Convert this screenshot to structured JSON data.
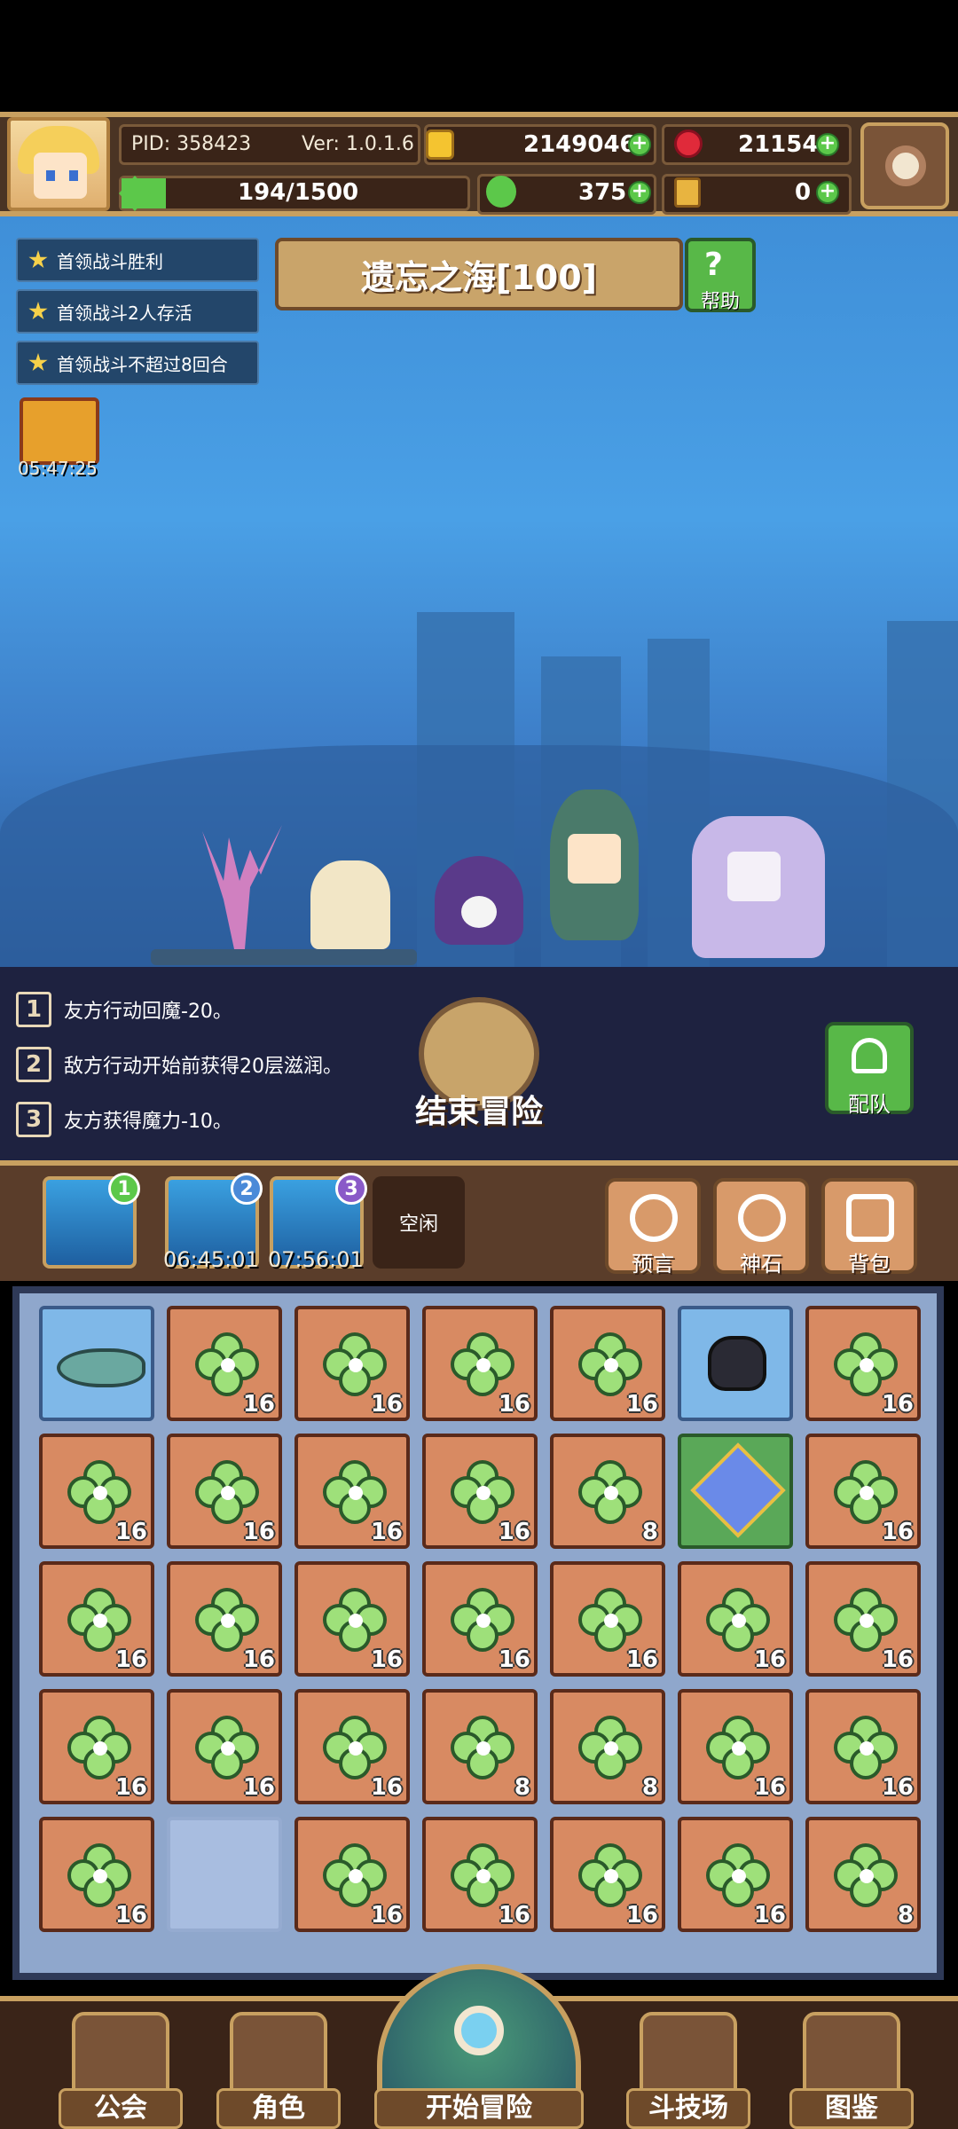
{
  "header": {
    "pid": "PID: 358423",
    "version": "Ver: 1.0.1.6",
    "exp": "194/1500",
    "exp_fraction": 0.129,
    "gold": "2149046",
    "gems": "21154",
    "clovers": "375",
    "keys": "0"
  },
  "quests": [
    "首领战斗胜利",
    "首领战斗2人存活",
    "首领战斗不超过8回合"
  ],
  "gift_timer": "05:47:25",
  "stage": {
    "title": "遗忘之海[100]",
    "help_label": "帮助"
  },
  "effects": [
    {
      "num": "1",
      "text": "友方行动回魔-20。"
    },
    {
      "num": "2",
      "text": "敌方行动开始前获得20层滋润。"
    },
    {
      "num": "3",
      "text": "友方获得魔力-10。"
    }
  ],
  "end_button_label": "结束冒险",
  "team_button_label": "配队",
  "slots": [
    {
      "num": "1",
      "timer": "",
      "color": "#5cc84a"
    },
    {
      "num": "2",
      "timer": "06:45:01",
      "color": "#4a8ad8"
    },
    {
      "num": "3",
      "timer": "07:56:01",
      "color": "#8a5ac8"
    }
  ],
  "idle_label": "空闲",
  "tools": [
    "预言",
    "神石",
    "背包"
  ],
  "inventory": [
    {
      "type": "fish",
      "count": ""
    },
    {
      "type": "clover",
      "count": "16"
    },
    {
      "type": "clover",
      "count": "16"
    },
    {
      "type": "clover",
      "count": "16"
    },
    {
      "type": "clover",
      "count": "16"
    },
    {
      "type": "cauldron",
      "count": ""
    },
    {
      "type": "clover",
      "count": "16"
    },
    {
      "type": "clover",
      "count": "16"
    },
    {
      "type": "clover",
      "count": "16"
    },
    {
      "type": "clover",
      "count": "16"
    },
    {
      "type": "clover",
      "count": "16"
    },
    {
      "type": "clover",
      "count": "8"
    },
    {
      "type": "crystal",
      "count": ""
    },
    {
      "type": "clover",
      "count": "16"
    },
    {
      "type": "clover",
      "count": "16"
    },
    {
      "type": "clover",
      "count": "16"
    },
    {
      "type": "clover",
      "count": "16"
    },
    {
      "type": "clover",
      "count": "16"
    },
    {
      "type": "clover",
      "count": "16"
    },
    {
      "type": "clover",
      "count": "16"
    },
    {
      "type": "clover",
      "count": "16"
    },
    {
      "type": "clover",
      "count": "16"
    },
    {
      "type": "clover",
      "count": "16"
    },
    {
      "type": "clover",
      "count": "16"
    },
    {
      "type": "clover",
      "count": "8"
    },
    {
      "type": "clover",
      "count": "8"
    },
    {
      "type": "clover",
      "count": "16"
    },
    {
      "type": "clover",
      "count": "16"
    },
    {
      "type": "clover",
      "count": "16"
    },
    {
      "type": "empty",
      "count": ""
    },
    {
      "type": "clover",
      "count": "16"
    },
    {
      "type": "clover",
      "count": "16"
    },
    {
      "type": "clover",
      "count": "16"
    },
    {
      "type": "clover",
      "count": "16"
    },
    {
      "type": "clover",
      "count": "8"
    }
  ],
  "nav": [
    "公会",
    "角色",
    "开始冒险",
    "斗技场",
    "图鉴"
  ]
}
